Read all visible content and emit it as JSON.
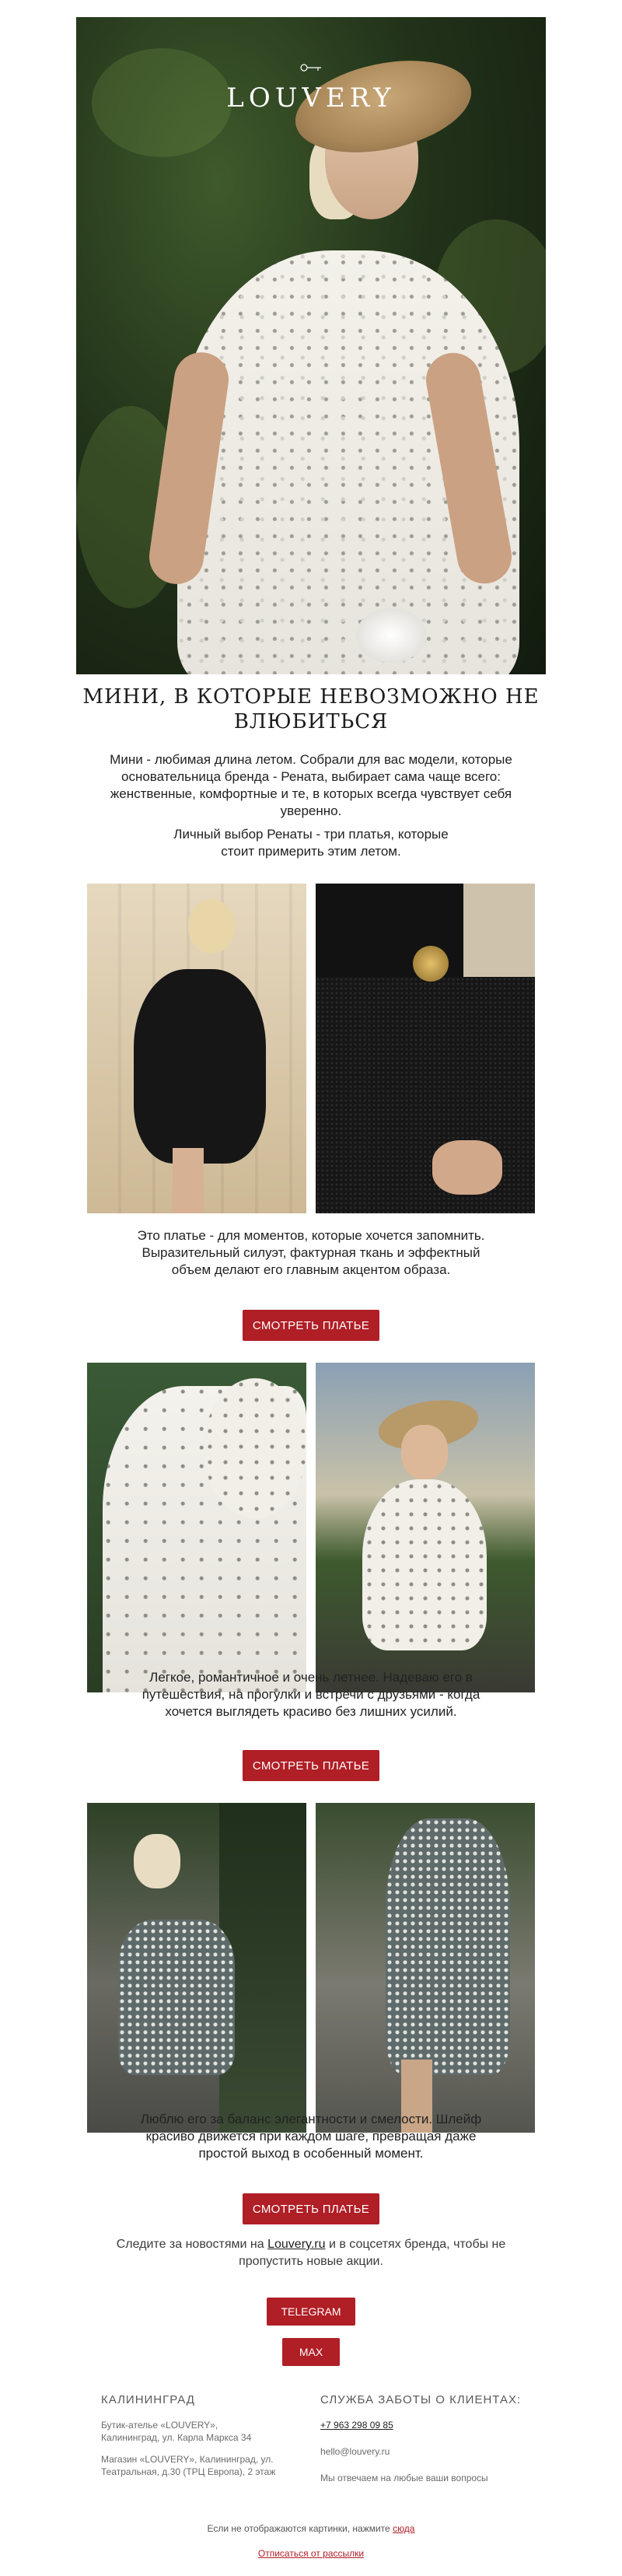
{
  "brand": {
    "logo": "LOUVERY"
  },
  "hero": {
    "image": "woman-in-straw-hat-and-white-seashell-print-dress"
  },
  "title": "МИНИ, В КОТОРЫЕ НЕВОЗМОЖНО НЕ ВЛЮБИТЬСЯ",
  "intro": [
    "Мини - любимая длина летом. Собрали для вас модели, которые основательница бренда - Рената, выбирает сама чаще всего: женственные, комфортные и те, в которых всегда чувствует себя уверенно.",
    "Личный выбор Ренаты - три платья, которые стоит примерить этим летом."
  ],
  "sections": [
    {
      "photos": [
        "black-one-shoulder-mini-dress",
        "black-dress-brooch-detail"
      ],
      "text": "Это платье - для моментов, которые хочется запомнить. Выразительный силуэт, фактурная ткань и эффектный объем делают его главным акцентом образа.",
      "button": "СМОТРЕТЬ ПЛАТЬЕ"
    },
    {
      "photos": [
        "white-print-dress-puff-sleeve-detail",
        "white-print-dress-with-hat"
      ],
      "text": "Легкое, романтичное и очень летнее. Надеваю его в путешествия, на прогулки и встречи с друзьями - когда хочется выглядеть красиво без лишних усилий.",
      "button": "СМОТРЕТЬ ПЛАТЬЕ"
    },
    {
      "photos": [
        "strapless-snake-print-mini-dress",
        "strapless-snake-print-dress-back"
      ],
      "text": "Люблю его за баланс элегантности и смелости. Шлейф красиво движется при каждом шаге, превращая даже простой выход в особенный момент.",
      "button": "СМОТРЕТЬ ПЛАТЬЕ"
    }
  ],
  "follow": {
    "before": "Следите за новостями на ",
    "link": "Louvery.ru",
    "after": " и в соцсетях бренда, чтобы не пропустить новые акции."
  },
  "social": {
    "telegram": "TELEGRAM",
    "max": "MAX"
  },
  "footer": {
    "city": {
      "heading": "КАЛИНИНГРАД",
      "stores": [
        "Бутик-ателье «LOUVERY», Калининград, ул. Карла Маркса 34",
        "Магазин «LOUVERY», Калининград, ул. Театральная, д.30 (ТРЦ Европа), 2 этаж"
      ]
    },
    "support": {
      "heading": "СЛУЖБА ЗАБОТЫ О КЛИЕНТАХ:",
      "phone": "+7 963 298 09 85",
      "email": "hello@louvery.ru",
      "note": "Мы отвечаем на любые ваши вопросы"
    },
    "images_note": "Если не отображаются картинки, нажмите ",
    "images_link": "сюда",
    "unsubscribe": "Отписаться от рассылки"
  },
  "colors": {
    "accent": "#b01e26",
    "text": "#1f1f1f"
  }
}
